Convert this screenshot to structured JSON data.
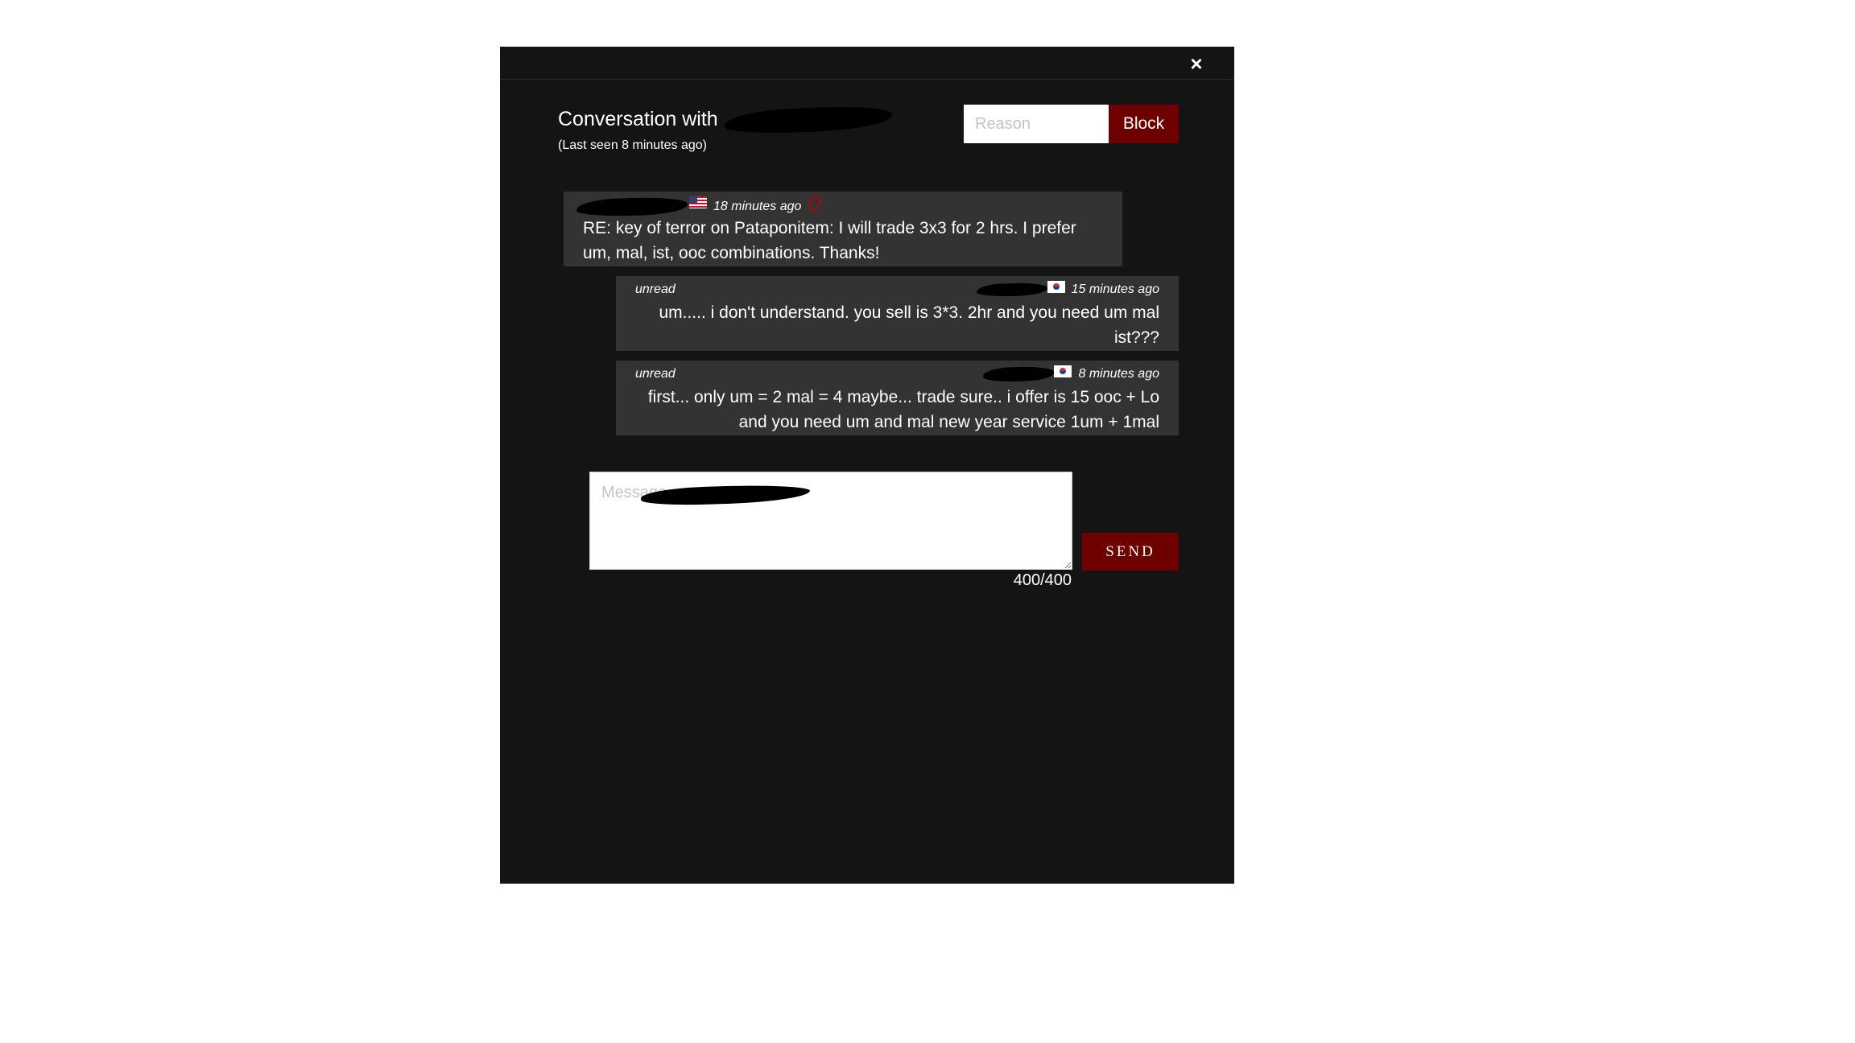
{
  "dialog": {
    "close_glyph": "×",
    "title_prefix": "Conversation with",
    "title_user": "",
    "last_seen": "(Last seen 8 minutes ago)"
  },
  "block": {
    "reason_placeholder": "Reason",
    "button_label": "Block"
  },
  "messages": [
    {
      "sender": "",
      "flag": "us-flag-icon",
      "time": "18 minutes ago",
      "status": "",
      "attachment_icon": "paperclip-icon",
      "text": "RE: key of terror on Pataponitem: I will trade 3x3 for 2 hrs. I prefer um, mal, ist, ooc combinations. Thanks!"
    },
    {
      "sender": "",
      "flag": "kr-flag-icon",
      "time": "15 minutes ago",
      "status": "unread",
      "text": "um..... i don't understand. you sell is 3*3. 2hr and you need um mal ist???"
    },
    {
      "sender": "",
      "flag": "kr-flag-icon",
      "time": "8 minutes ago",
      "status": "unread",
      "text": "first... only um = 2 mal = 4 maybe... trade sure.. i offer is 15 ooc + Lo and you need um and mal new year service 1um + 1mal"
    }
  ],
  "compose": {
    "placeholder": "Message",
    "char_count": "400/400",
    "send_label": "SEND"
  },
  "colors": {
    "modal_bg": "#141414",
    "message_bg": "#333333",
    "accent_red": "#6f0000"
  }
}
